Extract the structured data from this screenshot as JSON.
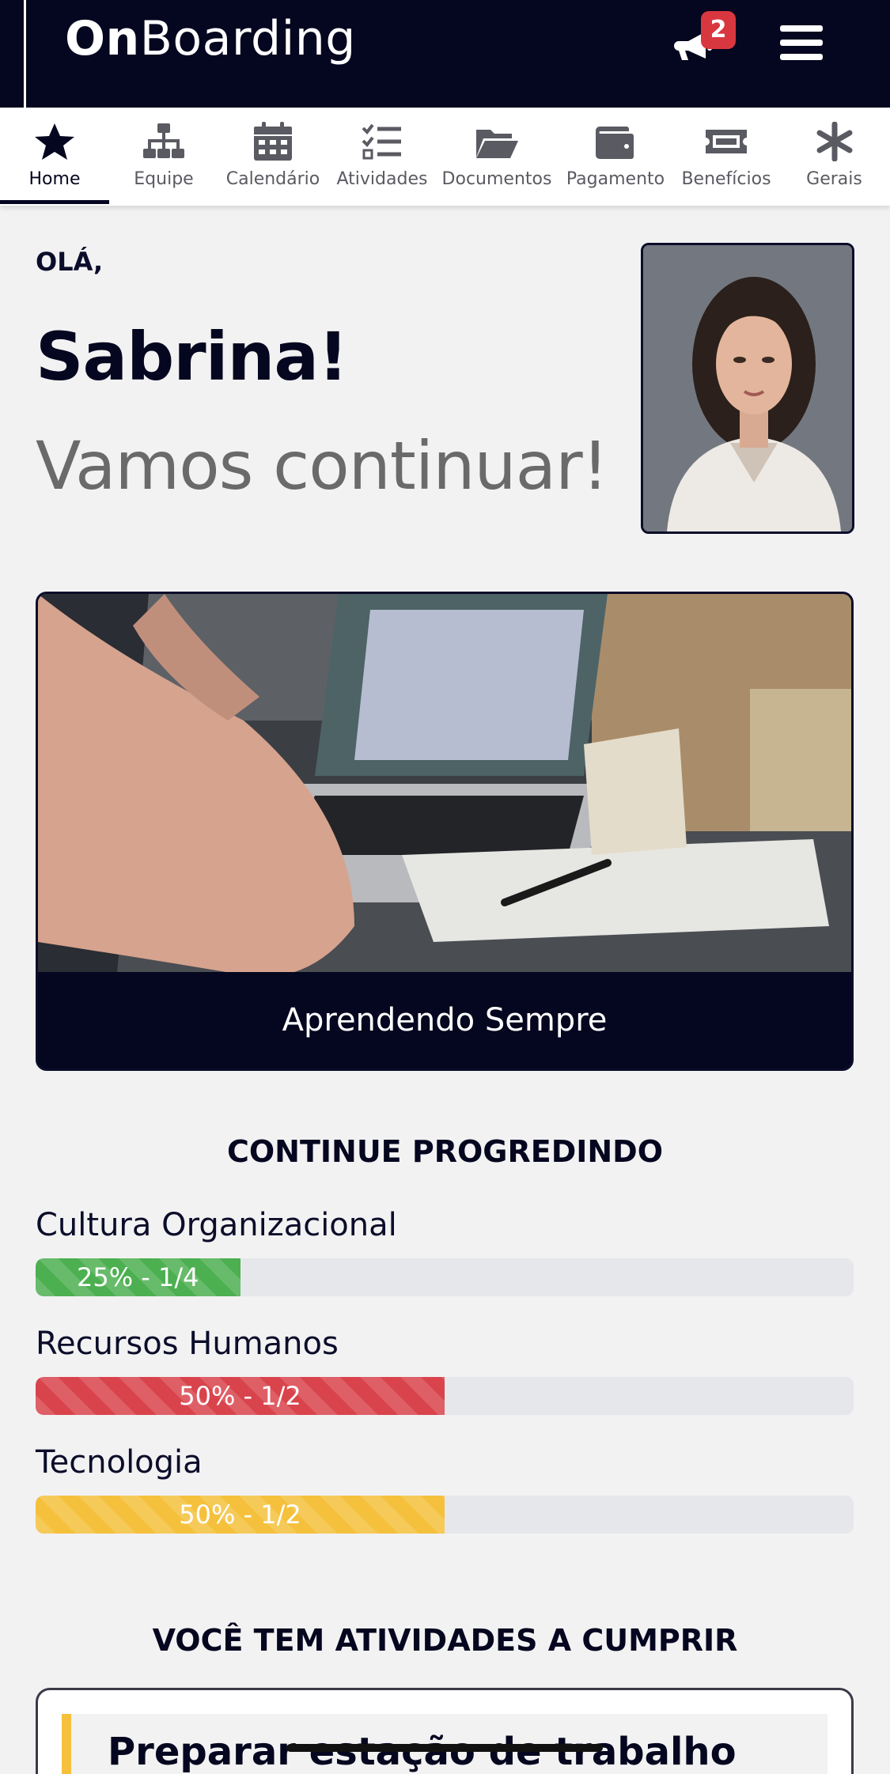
{
  "header": {
    "brand_bold": "On",
    "brand_rest": "Boarding",
    "notification_count": "2",
    "menu_icon": "hamburger-icon",
    "announce_icon": "megaphone-icon"
  },
  "tabs": [
    {
      "label": "Home",
      "icon": "star-icon",
      "active": true
    },
    {
      "label": "Equipe",
      "icon": "org-chart-icon",
      "active": false
    },
    {
      "label": "Calendário",
      "icon": "calendar-icon",
      "active": false
    },
    {
      "label": "Atividades",
      "icon": "tasks-icon",
      "active": false
    },
    {
      "label": "Documentos",
      "icon": "folder-icon",
      "active": false
    },
    {
      "label": "Pagamento",
      "icon": "wallet-icon",
      "active": false
    },
    {
      "label": "Benefícios",
      "icon": "ticket-icon",
      "active": false
    },
    {
      "label": "Gerais",
      "icon": "asterisk-icon",
      "active": false
    }
  ],
  "greeting": {
    "hello": "OLÁ,",
    "name": "Sabrina!",
    "subtitle": "Vamos continuar!"
  },
  "banner": {
    "caption": "Aprendendo Sempre"
  },
  "progress": {
    "title": "CONTINUE PROGREDINDO",
    "items": [
      {
        "label": "Cultura Organizacional",
        "text": "25% - 1/4",
        "percent": 25,
        "color": "#4caf50"
      },
      {
        "label": "Recursos Humanos",
        "text": "50% - 1/2",
        "percent": 50,
        "color": "#d9434b"
      },
      {
        "label": "Tecnologia",
        "text": "50% - 1/2",
        "percent": 50,
        "color": "#f5c13c"
      }
    ]
  },
  "activities": {
    "title": "VOCÊ TEM ATIVIDADES A CUMPRIR",
    "first_task": "Preparar estação de trabalho",
    "accent": "#f5c13c"
  },
  "colors": {
    "navy": "#05061f",
    "badge": "#d9373f"
  }
}
